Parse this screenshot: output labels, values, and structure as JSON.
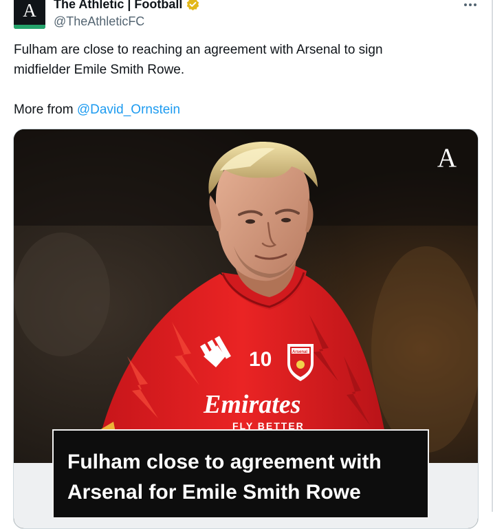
{
  "account": {
    "display_name": "The Athletic | Football",
    "handle": "@TheAthleticFC",
    "avatar_mark": "A",
    "verified_badge": "verified-gold-icon"
  },
  "actions": {
    "more_icon": "more-icon"
  },
  "post": {
    "text_line_1": "Fulham are close to reaching an agreement with Arsenal to sign",
    "text_line_2": "midfielder Emile Smith Rowe.",
    "more_from_label": "More from ",
    "mention": "@David_Ornstein"
  },
  "media": {
    "brand_mark": "A",
    "shirt_number": "10",
    "sponsor": "Emirates",
    "sponsor_sub": "FLY BETTER",
    "crest": "Arsenal",
    "headline_line_1": "Fulham close to agreement with",
    "headline_line_2": "Arsenal for Emile Smith Rowe"
  },
  "colors": {
    "link": "#1d9bf0",
    "handle": "#536471",
    "badge": "#e2b719",
    "avatar_accent": "#24a36b",
    "shirt": "#e41d1d"
  }
}
